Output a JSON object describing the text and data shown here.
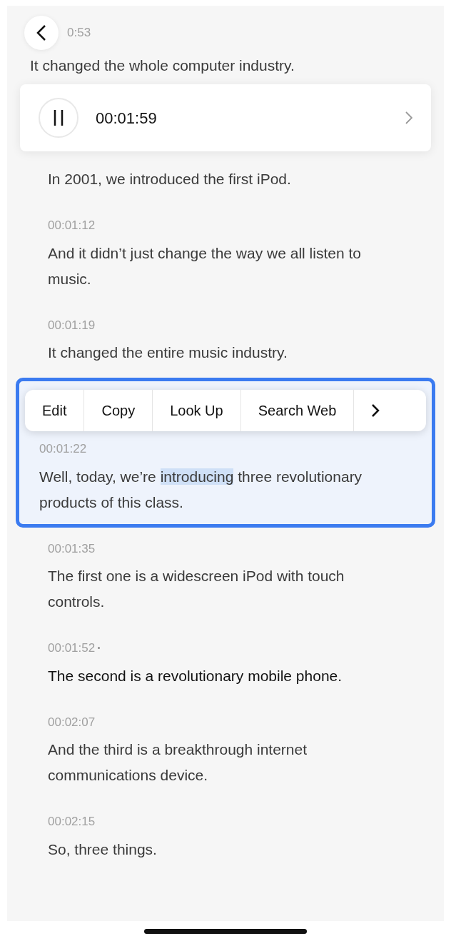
{
  "header": {
    "time": "0:53",
    "text": "It changed the whole computer industry."
  },
  "player": {
    "playing": true,
    "time": "00:01:59"
  },
  "segments": [
    {
      "text": "In 2001, we introduced the first iPod.",
      "active": false,
      "selected": false
    },
    {
      "time": "00:01:12",
      "text": "And it didn’t just change the way we all listen to music.",
      "active": false,
      "selected": false
    },
    {
      "time": "00:01:19",
      "text": "It changed the entire music industry.",
      "active": false,
      "selected": false
    },
    {
      "time": "00:01:22",
      "text_before": "Well, today, we’re ",
      "selection": "introducing",
      "text_after": " three revolutionary products of this class.",
      "active": false,
      "selected": true
    },
    {
      "time": "00:01:35",
      "text": "The first one is a widescreen iPod with touch controls.",
      "active": false,
      "selected": false
    },
    {
      "time": "00:01:52",
      "text": "The second is a revolutionary mobile phone.",
      "active": true,
      "selected": false
    },
    {
      "time": "00:02:07",
      "text": "And the third is a breakthrough internet communications device.",
      "active": false,
      "selected": false
    },
    {
      "time": "00:02:15",
      "text": "So, three things.",
      "active": false,
      "selected": false
    }
  ],
  "edit_menu": {
    "items": [
      "Edit",
      "Copy",
      "Look Up",
      "Search Web"
    ],
    "more": true
  }
}
